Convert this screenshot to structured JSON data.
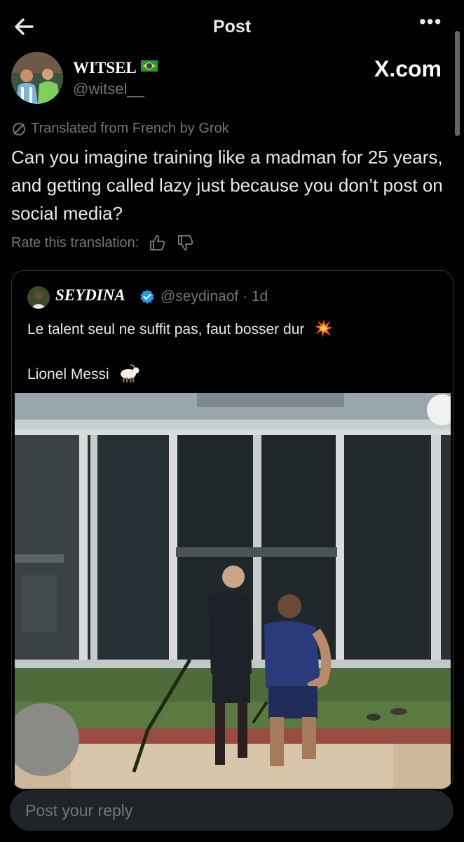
{
  "header": {
    "title": "Post",
    "more_glyph": "•••"
  },
  "post": {
    "author_name": "WITSEL",
    "author_handle": "@witsel__",
    "source": "X.com",
    "translated_label": "Translated from French by Grok",
    "text": "Can you imagine training like a madman for 25 years, and getting called lazy just because you don’t post on social media?",
    "rate_label": "Rate this translation:"
  },
  "quoted": {
    "author_name": "SEYDINA",
    "handle_time": "@seydinaof · 1d",
    "line1": "Le talent seul ne suffit pas, faut bosser dur",
    "line2": "Lionel Messi"
  },
  "reply": {
    "placeholder": "Post your reply"
  },
  "icons": [
    "back-arrow-icon",
    "more-icon",
    "brazil-flag-icon",
    "translate-icon",
    "thumbs-up-icon",
    "thumbs-down-icon",
    "verified-badge-icon",
    "collision-emoji-icon",
    "goat-emoji-icon"
  ],
  "colors": {
    "background": "#000000",
    "text": "#e7e9ea",
    "muted": "#71767b",
    "verified": "#1d9bf0",
    "border": "#2f3336"
  }
}
